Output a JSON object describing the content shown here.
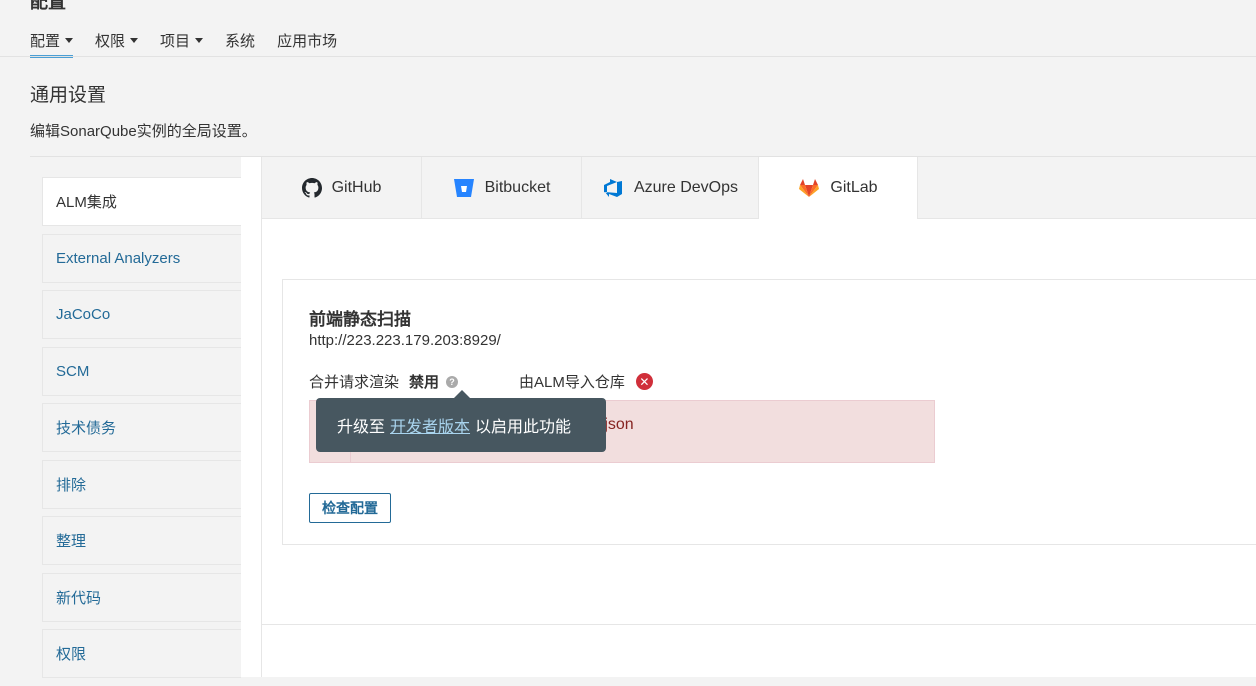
{
  "page": {
    "heading": "配置"
  },
  "nav": [
    {
      "label": "配置",
      "dropdown": true,
      "active": true
    },
    {
      "label": "权限",
      "dropdown": true,
      "active": false
    },
    {
      "label": "项目",
      "dropdown": true,
      "active": false
    },
    {
      "label": "系统",
      "dropdown": false,
      "active": false
    },
    {
      "label": "应用市场",
      "dropdown": false,
      "active": false
    }
  ],
  "section": {
    "title": "通用设置",
    "description": "编辑SonarQube实例的全局设置。"
  },
  "sidebar": {
    "items": [
      {
        "label": "ALM集成",
        "active": true
      },
      {
        "label": "External Analyzers"
      },
      {
        "label": "JaCoCo"
      },
      {
        "label": "SCM"
      },
      {
        "label": "技术债务"
      },
      {
        "label": "排除"
      },
      {
        "label": "整理"
      },
      {
        "label": "新代码"
      },
      {
        "label": "权限"
      }
    ]
  },
  "tabs": [
    {
      "label": "GitHub",
      "icon": "github-icon"
    },
    {
      "label": "Bitbucket",
      "icon": "bitbucket-icon"
    },
    {
      "label": "Azure DevOps",
      "icon": "azure-devops-icon"
    },
    {
      "label": "GitLab",
      "icon": "gitlab-icon",
      "active": true
    }
  ],
  "config": {
    "name": "前端静态扫描",
    "url": "http://223.223.179.203:8929/",
    "mr_decoration_label": "合并请求渲染",
    "mr_decoration_value": "禁用",
    "import_label": "由ALM导入仓库",
    "error_message": "o verify read permission. Got a non-json",
    "check_button": "检查配置"
  },
  "tooltip": {
    "prefix": "升级至",
    "link": "开发者版本",
    "suffix": "以启用此功能"
  },
  "colors": {
    "link": "#236a97",
    "active_tab_underline": "#4b9fd5",
    "error": "#d02f3a",
    "alert_bg": "#f2dede",
    "tooltip_bg": "#475760"
  }
}
